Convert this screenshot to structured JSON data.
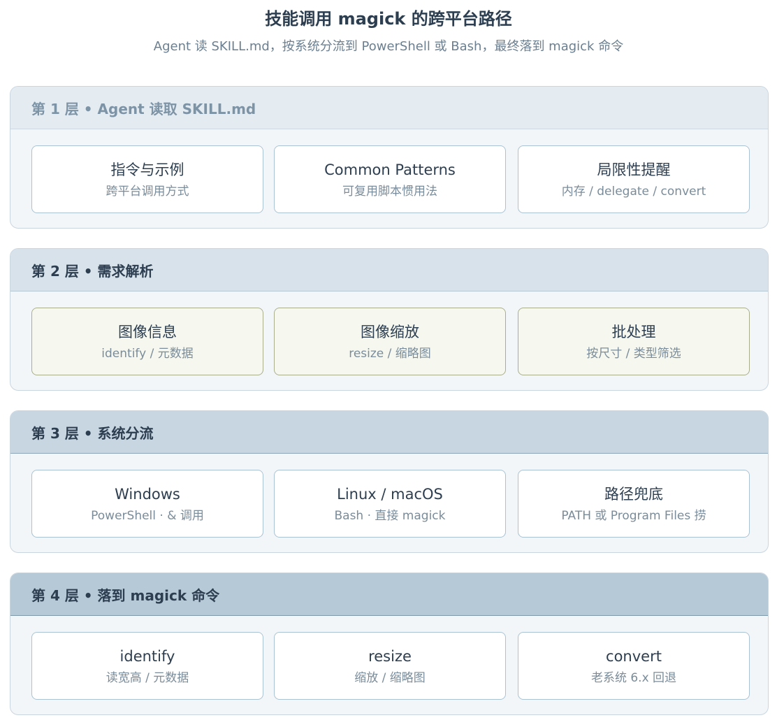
{
  "title": "技能调用 magick 的跨平台路径",
  "subtitle": "Agent 读 SKILL.md，按系统分流到 PowerShell 或 Bash，最终落到 magick 命令",
  "layers": [
    {
      "header": "第 1 层 • Agent 读取 SKILL.md",
      "cards": [
        {
          "title": "指令与示例",
          "sub": "跨平台调用方式"
        },
        {
          "title": "Common Patterns",
          "sub": "可复用脚本惯用法"
        },
        {
          "title": "局限性提醒",
          "sub": "内存 / delegate / convert"
        }
      ]
    },
    {
      "header": "第 2 层 • 需求解析",
      "cards": [
        {
          "title": "图像信息",
          "sub": "identify / 元数据"
        },
        {
          "title": "图像缩放",
          "sub": "resize / 缩略图"
        },
        {
          "title": "批处理",
          "sub": "按尺寸 / 类型筛选"
        }
      ]
    },
    {
      "header": "第 3 层 • 系统分流",
      "cards": [
        {
          "title": "Windows",
          "sub": "PowerShell · & 调用"
        },
        {
          "title": "Linux / macOS",
          "sub": "Bash · 直接 magick"
        },
        {
          "title": "路径兜底",
          "sub": "PATH 或 Program Files 捞"
        }
      ]
    },
    {
      "header": "第 4 层 • 落到 magick 命令",
      "cards": [
        {
          "title": "identify",
          "sub": "读宽高 / 元数据"
        },
        {
          "title": "resize",
          "sub": "缩放 / 缩略图"
        },
        {
          "title": "convert",
          "sub": "老系统 6.x 回退"
        }
      ]
    }
  ]
}
